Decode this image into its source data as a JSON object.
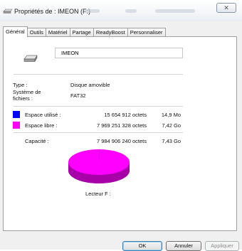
{
  "window": {
    "title": "Propriétés de : IMEON (F:)"
  },
  "tabs": [
    {
      "label": "Général",
      "active": true
    },
    {
      "label": "Outils"
    },
    {
      "label": "Matériel"
    },
    {
      "label": "Partage"
    },
    {
      "label": "ReadyBoost"
    },
    {
      "label": "Personnaliser"
    }
  ],
  "general": {
    "drive_name": "IMEON",
    "type_label": "Type :",
    "type_value": "Disque amovible",
    "fs_label": "Système de fichiers :",
    "fs_value": "FAT32",
    "used": {
      "label": "Espace utilisé :",
      "bytes": "15 654 912 octets",
      "size": "14,9 Mo",
      "color": "#0000ff"
    },
    "free": {
      "label": "Espace libre :",
      "bytes": "7 969 251 328 octets",
      "size": "7,42 Go",
      "color": "#ff00ff"
    },
    "capacity": {
      "label": "Capacité :",
      "bytes": "7 984 906 240 octets",
      "size": "7,43 Go"
    },
    "drive_caption": "Lecteur F :",
    "used_fraction": 0.002
  },
  "buttons": {
    "ok": "OK",
    "cancel": "Annuler",
    "apply": "Appliquer"
  }
}
